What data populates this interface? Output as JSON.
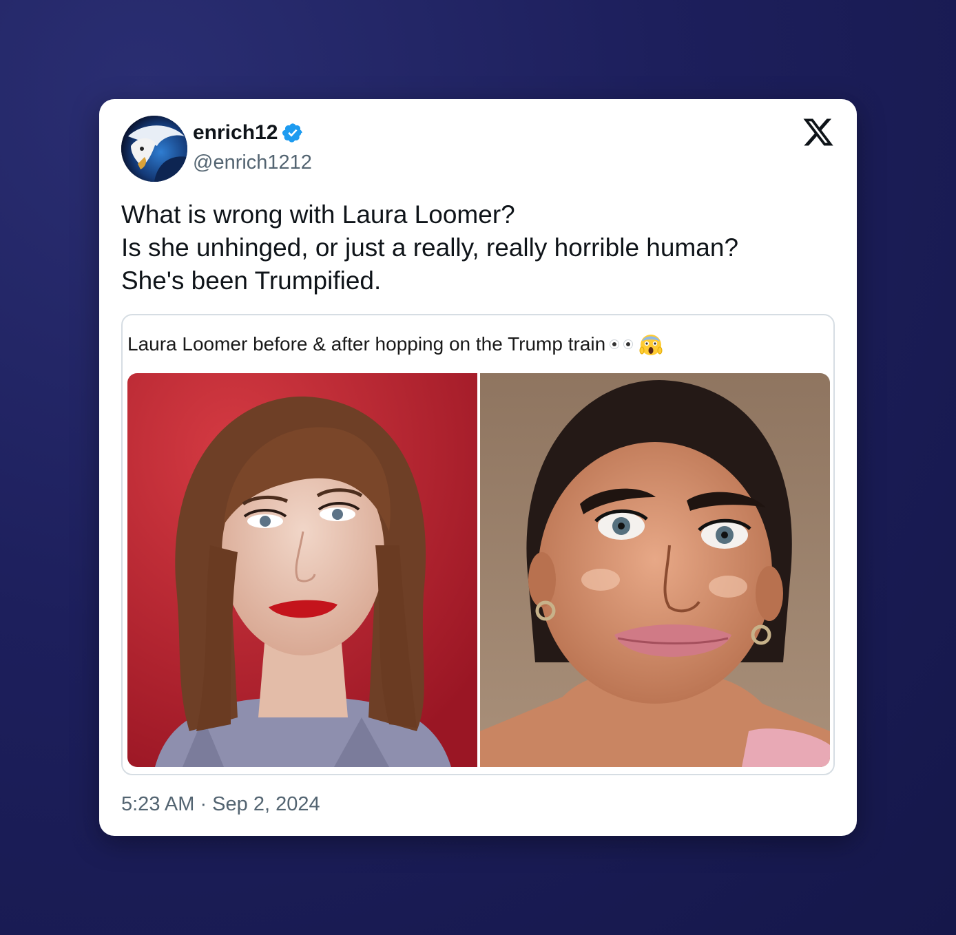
{
  "tweet": {
    "display_name": "enrich12",
    "handle": "@enrich1212",
    "verified": true,
    "text_lines": [
      "What is wrong with Laura Loomer?",
      "Is she unhinged, or just a really, really horrible human?",
      "She's been Trumpified."
    ],
    "timestamp": "5:23 AM · Sep 2, 2024"
  },
  "quoted_image": {
    "caption": "Laura Loomer before & after hopping on the Trump train",
    "caption_emoji": [
      "eyes-emoji",
      "screaming-face-emoji"
    ],
    "panels": [
      "before-photo",
      "after-photo"
    ]
  },
  "icons": {
    "platform_logo": "x-logo-icon",
    "verified_badge": "verified-badge-icon"
  },
  "colors": {
    "background": "#1d1f5c",
    "card": "#ffffff",
    "text_primary": "#0f1419",
    "text_secondary": "#536471",
    "verified_blue": "#1d9bf0",
    "border": "#d6dde3"
  }
}
